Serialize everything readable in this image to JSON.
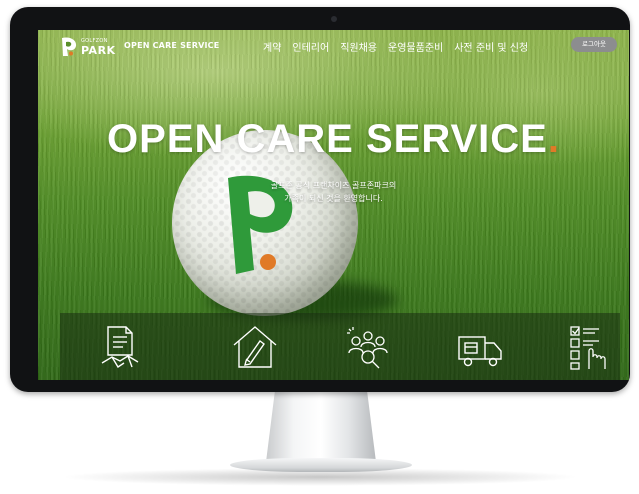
{
  "brand": {
    "small": "GOLFZON",
    "big": "PARK",
    "service": "OPEN CARE SERVICE"
  },
  "nav": {
    "items": [
      "계약",
      "인테리어",
      "직원채용",
      "운영물품준비",
      "사전 준비 및 신청"
    ],
    "logout_label": "로그아웃"
  },
  "hero": {
    "title": "OPEN CARE SERVICE",
    "title_dot": ".",
    "subtitle_line1": "골프존 공식 프랜차이즈 골프존파크의",
    "subtitle_line2": "가족이 되신 것을 환영합니다."
  },
  "services": [
    {
      "icon": "contract-document-icon"
    },
    {
      "icon": "house-pen-icon"
    },
    {
      "icon": "staff-search-icon"
    },
    {
      "icon": "delivery-truck-icon"
    },
    {
      "icon": "checklist-touch-icon"
    }
  ],
  "colors": {
    "accent_orange": "#e07a27",
    "brand_green": "#2f9a3a",
    "logout_gray": "#8c8d8f"
  }
}
